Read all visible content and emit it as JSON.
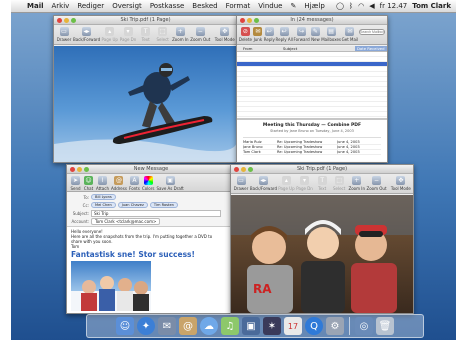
{
  "menubar": {
    "apple": "",
    "items": [
      "Mail",
      "Arkiv",
      "Rediger",
      "Oversigt",
      "Postkasse",
      "Besked",
      "Format",
      "Vindue"
    ],
    "help": "Hjælp",
    "clock": "fr 12.47",
    "user": "Tom Clark"
  },
  "preview_top": {
    "title": "Ski Trip.pdf (1 Page)",
    "toolbar": [
      "Drawer",
      "Back/Forward",
      "Page Up",
      "Page Dn",
      "Text",
      "Select",
      "Zoom In",
      "Zoom Out",
      "Tool Mode"
    ]
  },
  "mail_viewer": {
    "title": "In (24 messages)",
    "toolbar": [
      "Delete",
      "Junk",
      "Reply",
      "Reply All",
      "Forward",
      "New",
      "Mailboxes",
      "Get Mail"
    ],
    "search_placeholder": "Search Mailbox",
    "columns": [
      "From",
      "Subject",
      "Date Received"
    ],
    "preview_subject": "Meeting this Thursday — Combine PDF",
    "preview_from": "Started by Jane Bruno on Tuesday, June 4, 2003",
    "thread": [
      {
        "name": "Maria Ruiz",
        "subject": "Re: Upcoming Tradeshow",
        "date": "June 4, 2003"
      },
      {
        "name": "Jane Bruno",
        "subject": "Re: Upcoming Tradeshow",
        "date": "June 4, 2003"
      },
      {
        "name": "Tom Clark",
        "subject": "Re: Upcoming Tradeshow",
        "date": "June 4, 2003"
      }
    ]
  },
  "compose": {
    "title": "New Message",
    "toolbar": [
      "Send",
      "Chat",
      "Attach",
      "Address",
      "Fonts",
      "Colors",
      "Save As Draft"
    ],
    "to_label": "To:",
    "to_value": "Bill Lyons",
    "cc_label": "Cc:",
    "cc_chips": [
      "Mei Chen",
      "Juan Chavez",
      "Tim Rosten"
    ],
    "subject_label": "Subject:",
    "subject_value": "Ski Trip",
    "account_label": "Account:",
    "account_value": "Tom Clark <tclark@mac.com>",
    "greeting": "Hello everyone!",
    "body": "Here are all the snapshots from the trip. I'm putting together a DVD to share with you soon.",
    "signoff": "Tom",
    "headline": "Fantastisk sne! Stor success!"
  },
  "preview_bottom": {
    "title": "Ski Trip.pdf (1 Page)",
    "toolbar": [
      "Drawer",
      "Back/Forward",
      "Page Up",
      "Page Dn",
      "Text",
      "Select",
      "Zoom In",
      "Zoom Out",
      "Tool Mode"
    ]
  }
}
